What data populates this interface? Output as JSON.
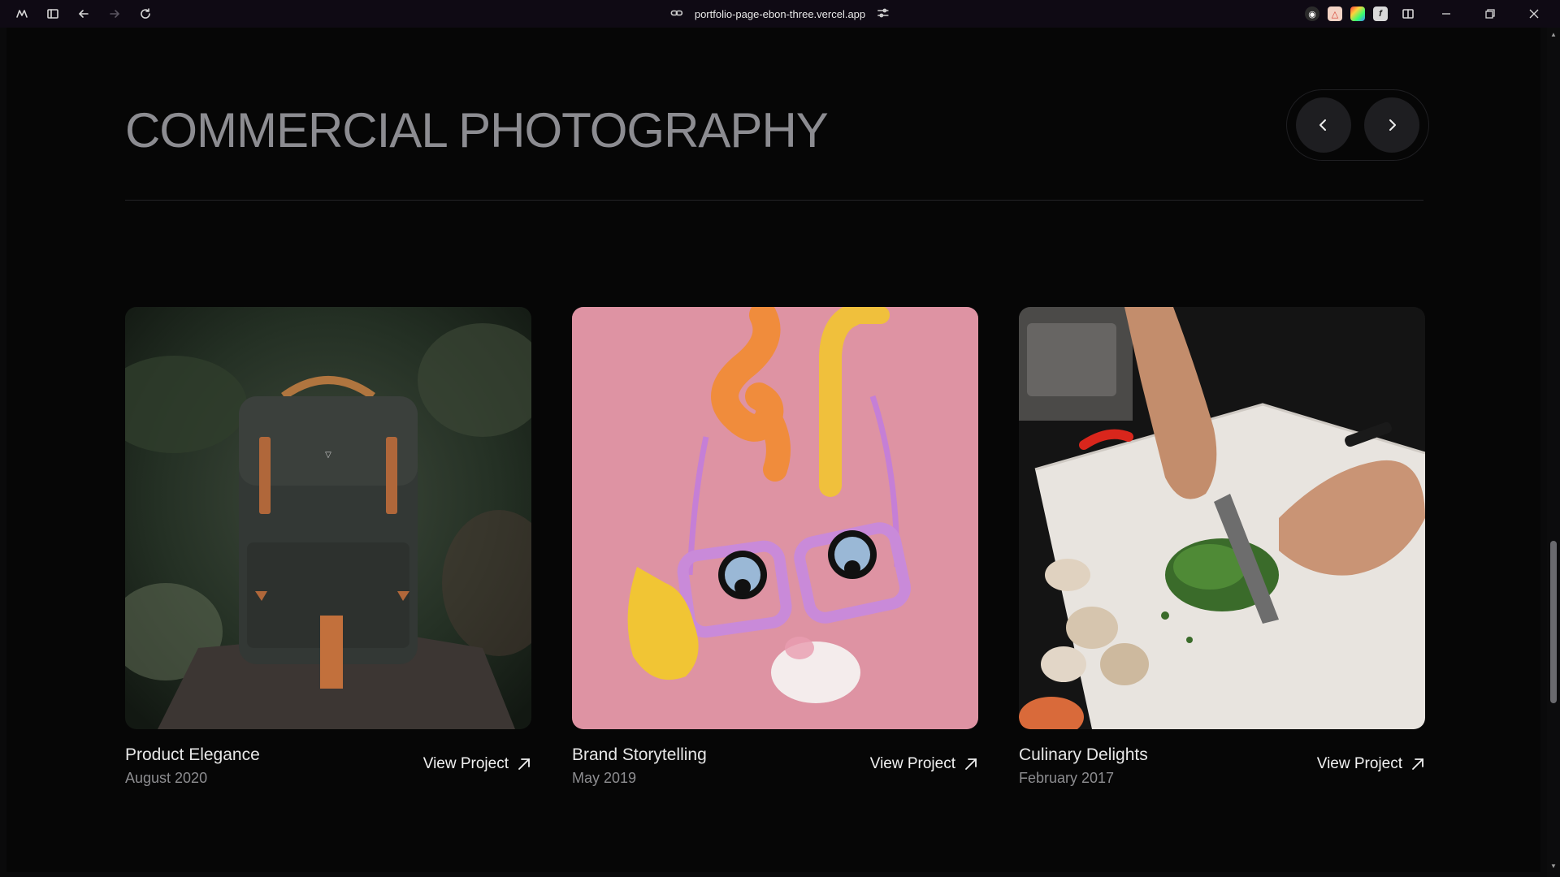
{
  "browser": {
    "url": "portfolio-page-ebon-three.vercel.app"
  },
  "page": {
    "section_title": "COMMERCIAL PHOTOGRAPHY"
  },
  "cards": [
    {
      "title": "Product Elegance",
      "date": "August 2020",
      "link_label": "View Project"
    },
    {
      "title": "Brand Storytelling",
      "date": "May 2019",
      "link_label": "View Project"
    },
    {
      "title": "Culinary Delights",
      "date": "February 2017",
      "link_label": "View Project"
    }
  ],
  "icons": {
    "browser_logo": "arc-logo-icon",
    "sidebar": "sidebar-toggle-icon",
    "back": "arrow-left-icon",
    "forward": "arrow-right-icon",
    "reload": "reload-icon",
    "link": "link-icon",
    "site_settings": "sliders-icon",
    "prev": "chevron-left-icon",
    "next": "chevron-right-icon",
    "external": "arrow-up-right-icon"
  },
  "colors": {
    "background": "#060606",
    "title": "#8c8c91",
    "nav_button": "#1e1e21"
  }
}
